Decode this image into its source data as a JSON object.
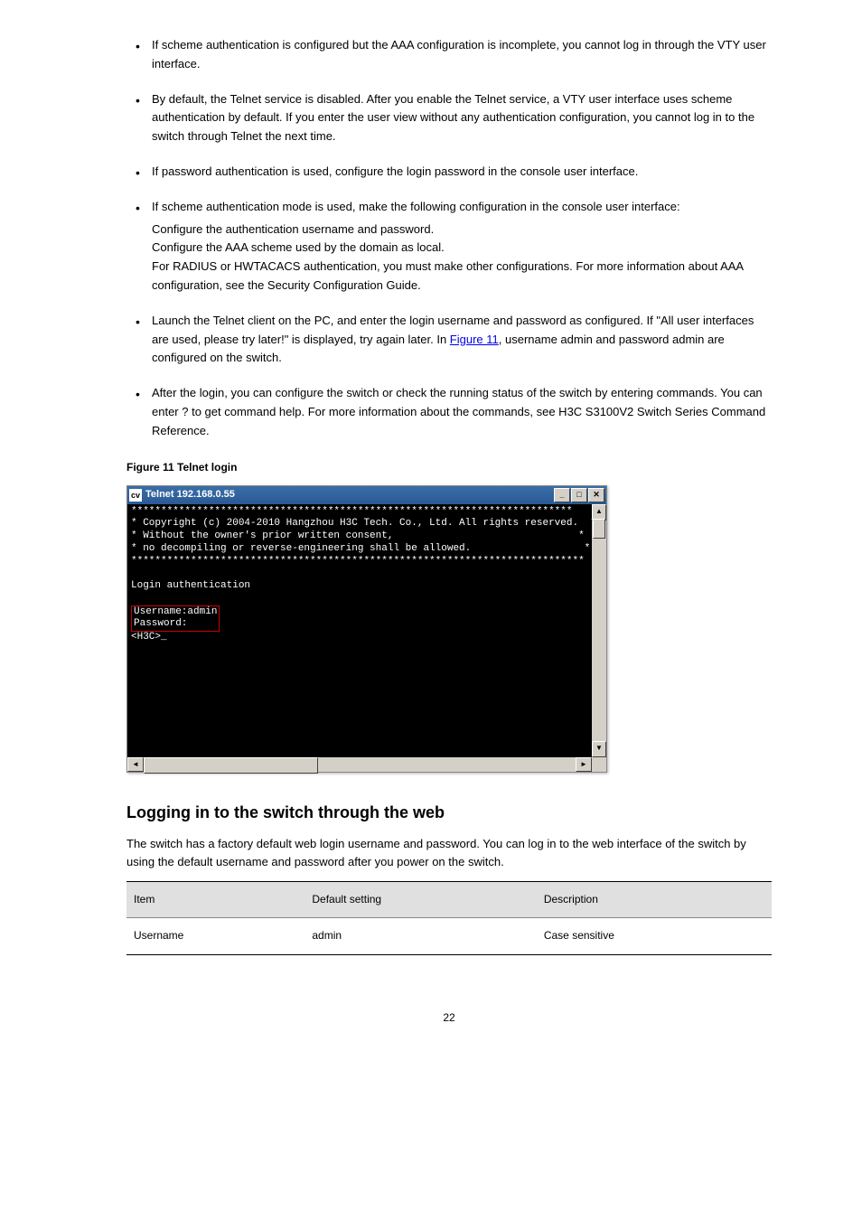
{
  "page_number": "22",
  "bullets": [
    {
      "text": "If scheme authentication is configured but the AAA configuration is incomplete, you cannot log in through the VTY user interface.",
      "sub": null
    },
    {
      "text": "By default, the Telnet service is disabled. After you enable the Telnet service, a VTY user interface uses scheme authentication by default. If you enter the user view without any authentication configuration, you cannot log in to the switch through Telnet the next time.",
      "sub": null
    },
    {
      "text": "If password authentication is used, configure the login password in the console user interface.",
      "sub": null
    },
    {
      "text": "If scheme authentication mode is used, make the following configuration in the console user interface:",
      "sub": "Configure the authentication username and password.\nConfigure the AAA scheme used by the domain as local.\nFor RADIUS or HWTACACS authentication, you must make other configurations. For more information about AAA configuration, see the Security Configuration Guide."
    },
    {
      "text": "Launch the Telnet client on the PC, and enter the login username and password as configured. If \"All user interfaces are used, please try later!\" is displayed, try again later. In ",
      "link_text": "Figure 11",
      "after_link": ", username admin and password admin are configured on the switch."
    },
    {
      "text": "After the login, you can configure the switch or check the running status of the switch by entering commands. You can enter ? to get command help. For more information about the commands, see H3C S3100V2 Switch Series Command Reference.",
      "sub": null
    }
  ],
  "figure_caption": "Figure 11 Telnet login",
  "terminal": {
    "title": "Telnet 192.168.0.55",
    "window_icon": "cv",
    "lines_top": "**************************************************************************\n* Copyright (c) 2004-2010 Hangzhou H3C Tech. Co., Ltd. All rights reserved.  *\n* Without the owner's prior written consent,                               *\n* no decompiling or reverse-engineering shall be allowed.                   *\n****************************************************************************",
    "login_auth": "Login authentication",
    "boxed_lines": "Username:admin\nPassword:",
    "prompt": "<H3C>_"
  },
  "section_heading": "Logging in to the switch through the web",
  "section_text": "The switch has a factory default web login username and password. You can log in to the web interface of the switch by using the default username and password after you power on the switch.",
  "table": {
    "headers": [
      "Item",
      "Default setting",
      "Description"
    ],
    "row": [
      "Username",
      "admin",
      "Case sensitive"
    ]
  }
}
